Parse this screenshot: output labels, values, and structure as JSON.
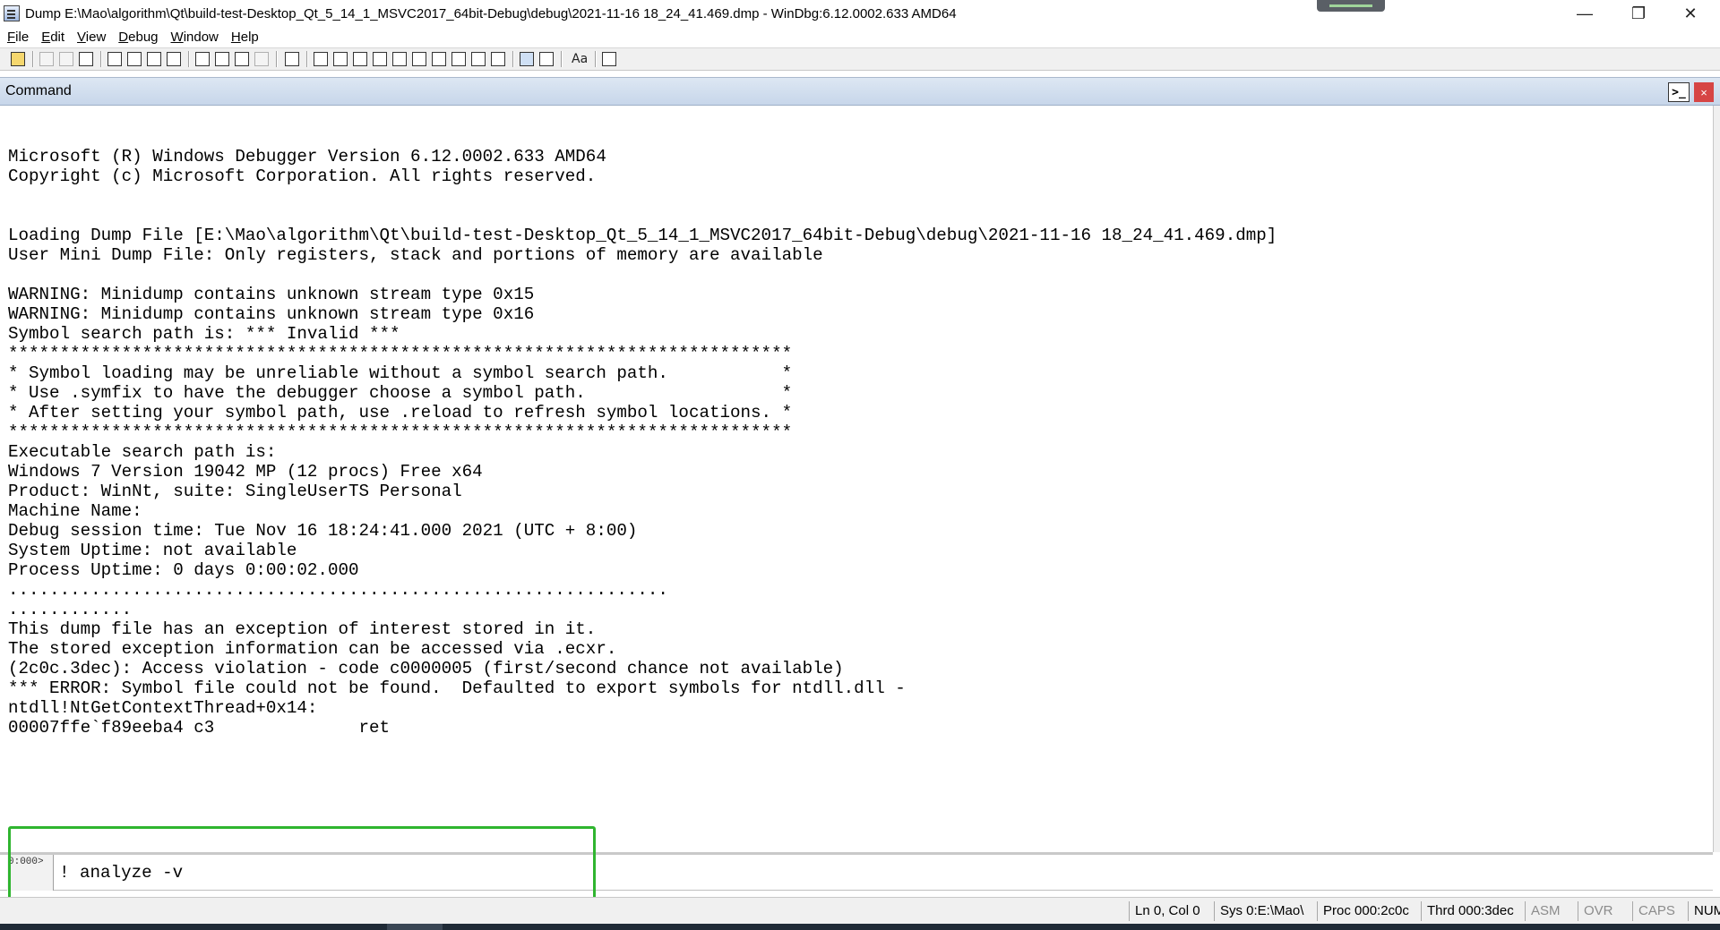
{
  "window": {
    "title": "Dump E:\\Mao\\algorithm\\Qt\\build-test-Desktop_Qt_5_14_1_MSVC2017_64bit-Debug\\debug\\2021-11-16 18_24_41.469.dmp - WinDbg:6.12.0002.633 AMD64",
    "app_icon": "windbg-app-icon",
    "controls": {
      "minimize": "—",
      "restore": "❐",
      "close": "✕"
    }
  },
  "menu": [
    {
      "underline": "F",
      "rest": "ile"
    },
    {
      "underline": "E",
      "rest": "dit"
    },
    {
      "underline": "V",
      "rest": "iew"
    },
    {
      "underline": "D",
      "rest": "ebug"
    },
    {
      "underline": "W",
      "rest": "indow"
    },
    {
      "underline": "H",
      "rest": "elp"
    }
  ],
  "command_window": {
    "title": "Command",
    "dock_label": ">_",
    "close_label": "×"
  },
  "output_lines": [
    "",
    "Microsoft (R) Windows Debugger Version 6.12.0002.633 AMD64",
    "Copyright (c) Microsoft Corporation. All rights reserved.",
    "",
    "",
    "Loading Dump File [E:\\Mao\\algorithm\\Qt\\build-test-Desktop_Qt_5_14_1_MSVC2017_64bit-Debug\\debug\\2021-11-16 18_24_41.469.dmp]",
    "User Mini Dump File: Only registers, stack and portions of memory are available",
    "",
    "WARNING: Minidump contains unknown stream type 0x15",
    "WARNING: Minidump contains unknown stream type 0x16",
    "Symbol search path is: *** Invalid ***",
    "****************************************************************************",
    "* Symbol loading may be unreliable without a symbol search path.           *",
    "* Use .symfix to have the debugger choose a symbol path.                   *",
    "* After setting your symbol path, use .reload to refresh symbol locations. *",
    "****************************************************************************",
    "Executable search path is:",
    "Windows 7 Version 19042 MP (12 procs) Free x64",
    "Product: WinNt, suite: SingleUserTS Personal",
    "Machine Name:",
    "Debug session time: Tue Nov 16 18:24:41.000 2021 (UTC + 8:00)",
    "System Uptime: not available",
    "Process Uptime: 0 days 0:00:02.000",
    "................................................................",
    "............",
    "This dump file has an exception of interest stored in it.",
    "The stored exception information can be accessed via .ecxr.",
    "(2c0c.3dec): Access violation - code c0000005 (first/second chance not available)",
    "*** ERROR: Symbol file could not be found.  Defaulted to export symbols for ntdll.dll -",
    "ntdll!NtGetContextThread+0x14:",
    "00007ffe`f89eeba4 c3              ret"
  ],
  "input": {
    "prompt": "0:000>",
    "value": "! analyze -v"
  },
  "status": {
    "position": "Ln 0, Col 0",
    "sys": "Sys 0:E:\\Mao\\",
    "proc": "Proc 000:2c0c",
    "thrd": "Thrd 000:3dec",
    "asm": "ASM",
    "ovr": "OVR",
    "caps": "CAPS",
    "num": "NUM"
  },
  "colors": {
    "highlight_box": "#2fb52f",
    "command_header": "#c7d6ea",
    "close_button": "#d64545"
  }
}
